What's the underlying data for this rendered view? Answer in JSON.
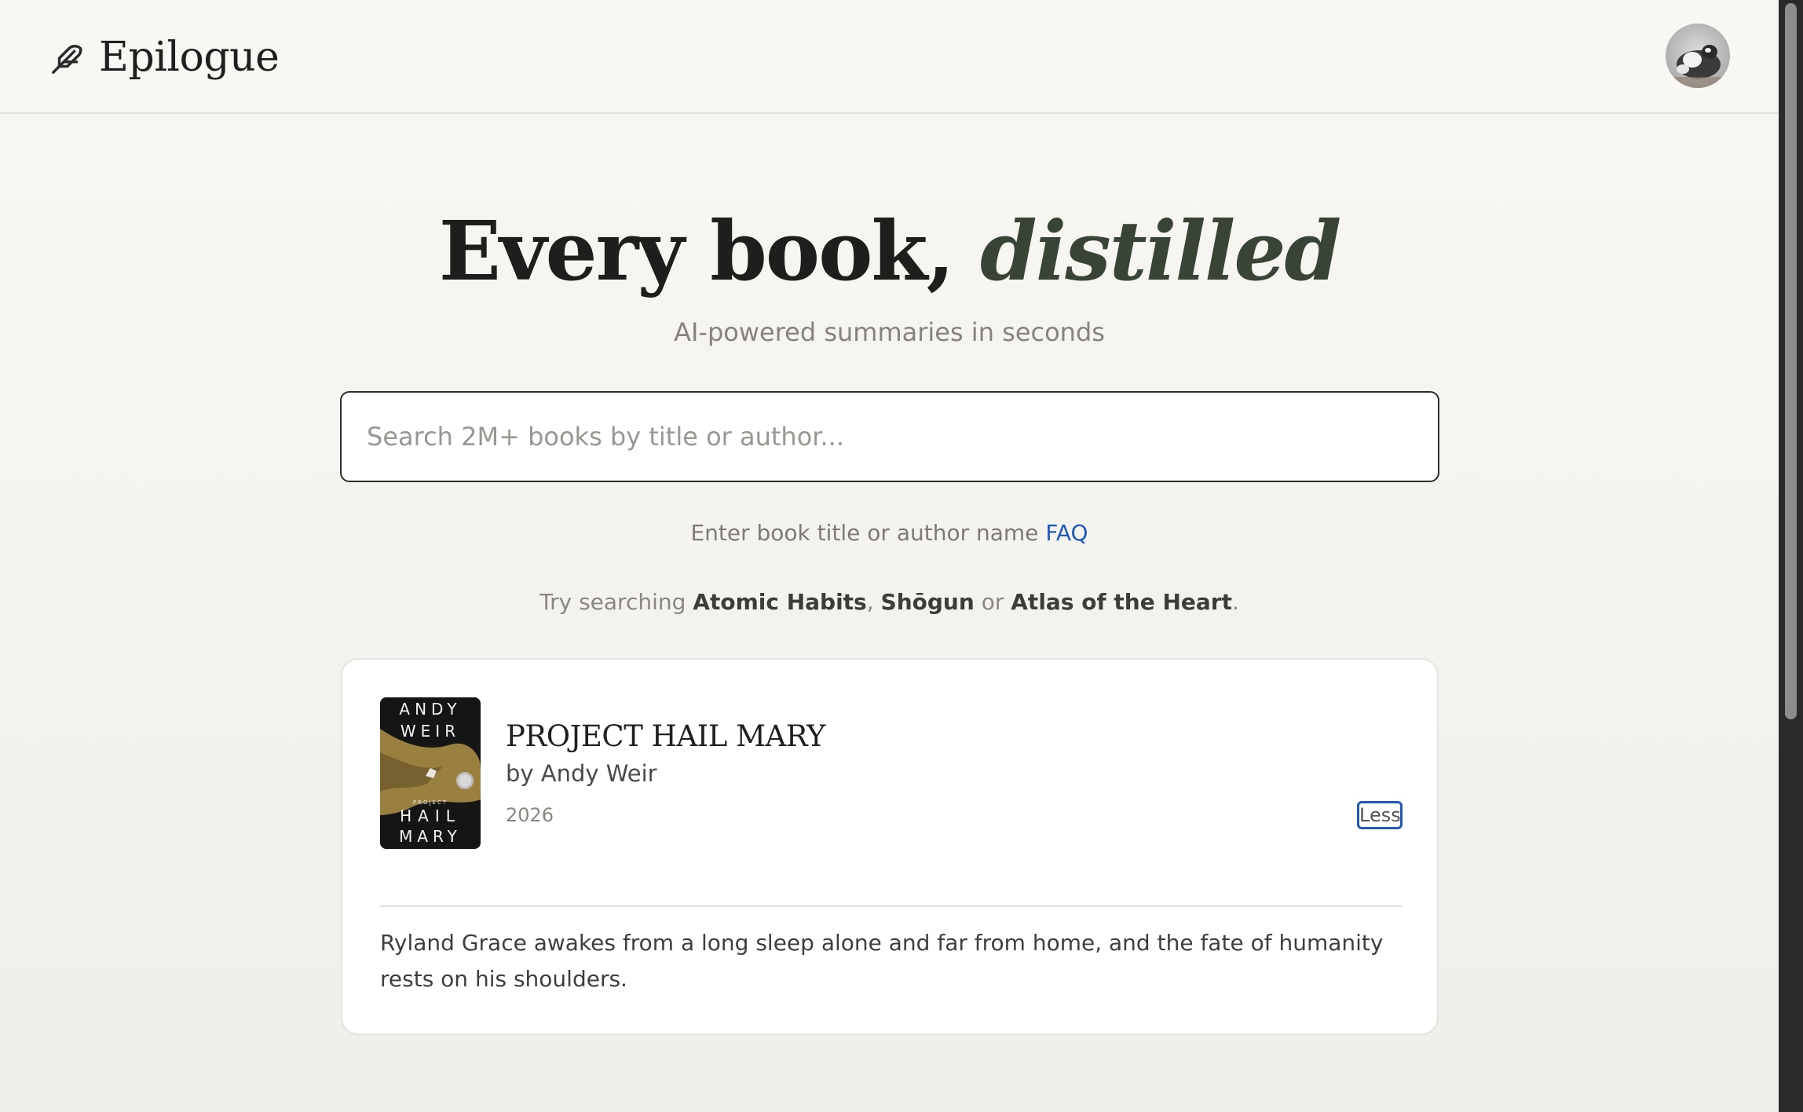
{
  "header": {
    "logo_text": "Epilogue",
    "logo_icon": "feather-icon",
    "avatar": "user-avatar"
  },
  "hero": {
    "title_main": "Every book, ",
    "title_emphasis": "distilled",
    "subtitle": "AI-powered summaries in seconds"
  },
  "search": {
    "placeholder": "Search 2M+ books by title or author...",
    "value": "",
    "hint_text": "Enter book title or author name",
    "faq_label": "FAQ"
  },
  "suggestions": {
    "prefix": "Try searching",
    "items": [
      "Atomic Habits",
      "Shōgun",
      "Atlas of the Heart"
    ],
    "separator": ",",
    "conjunction": "or",
    "end": "."
  },
  "book": {
    "title": "PROJECT HAIL MARY",
    "author": "by Andy Weir",
    "year": "2026",
    "toggle_label": "Less",
    "description": "Ryland Grace awakes from a long sleep alone and far from home, and the fate of humanity rests on his shoulders.",
    "cover": {
      "line1": "ANDY",
      "line2": "WEIR",
      "tag": "PROJECT",
      "line3": "HAIL",
      "line4": "MARY"
    }
  },
  "colors": {
    "accent_link": "#1e5ab8",
    "title_emphasis": "#3a4436",
    "background": "#f4f2ee"
  }
}
